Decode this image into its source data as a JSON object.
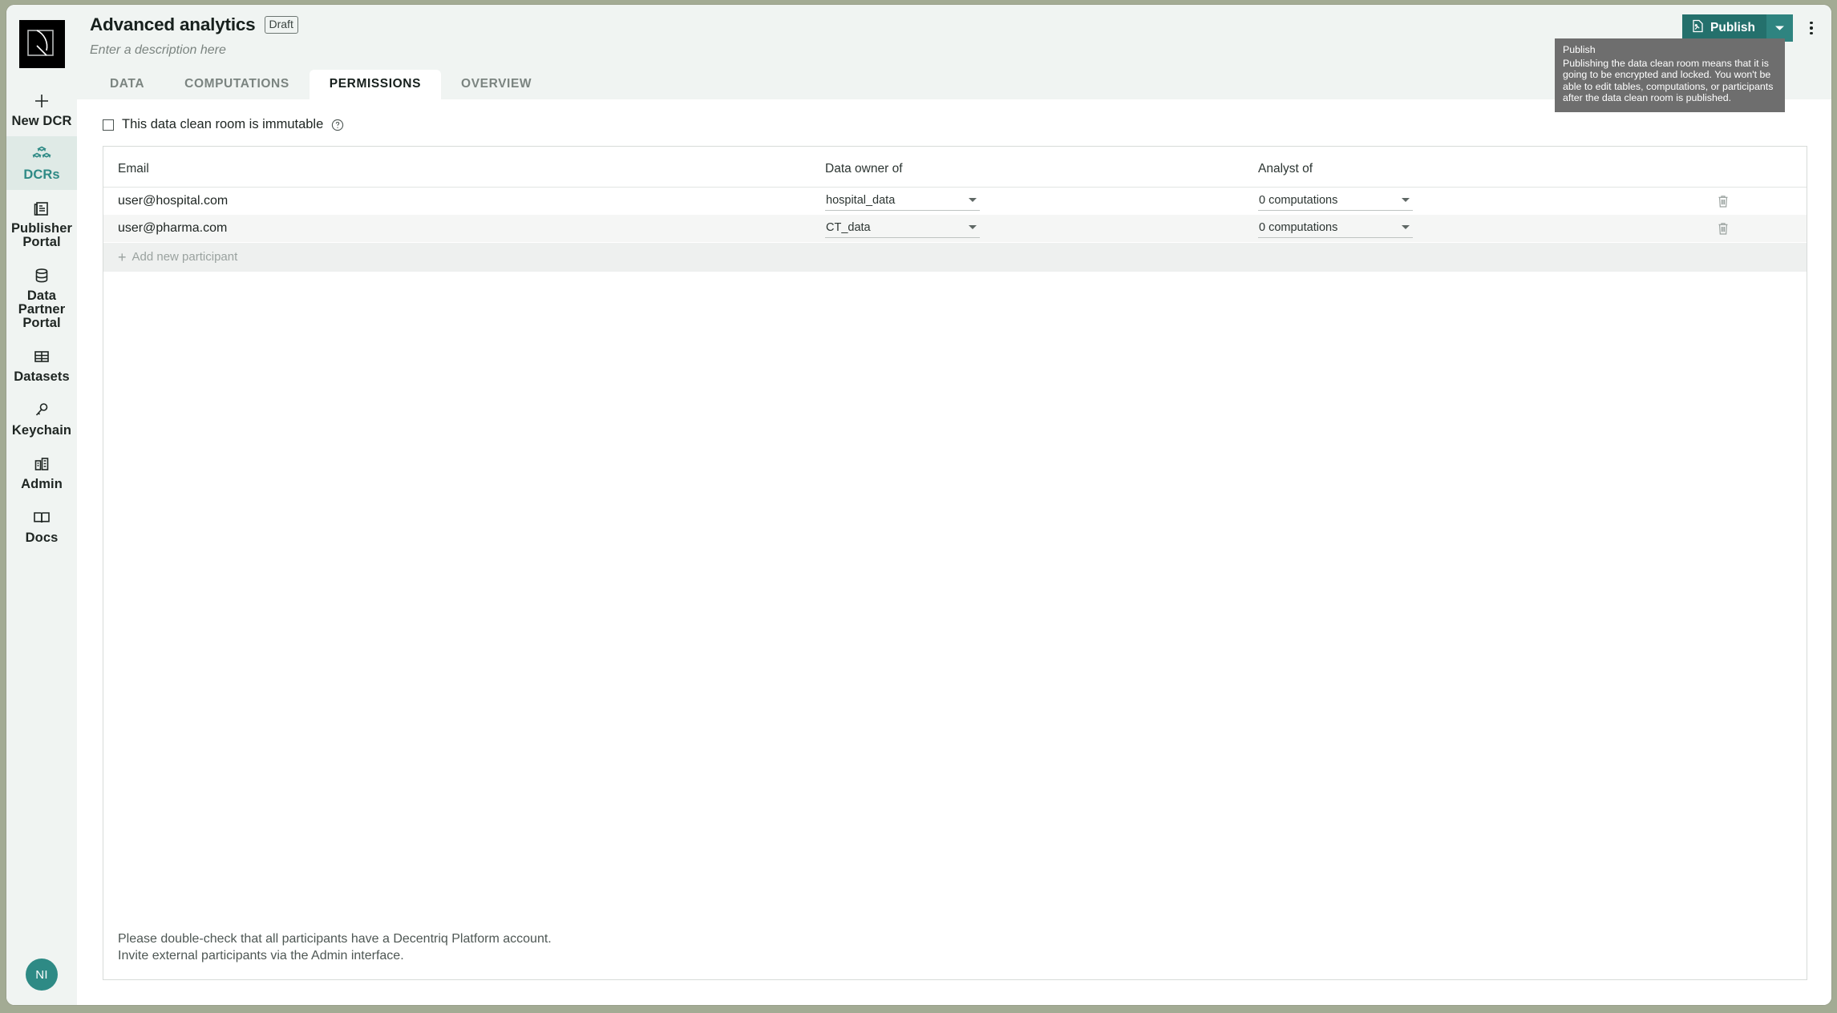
{
  "window": {
    "logo_name": "decentriq-logo"
  },
  "sidebar": {
    "items": [
      {
        "label": "New DCR",
        "icon": "plus-icon",
        "active": false
      },
      {
        "label": "DCRs",
        "icon": "cubes-icon",
        "active": true
      },
      {
        "label": "Publisher Portal",
        "icon": "newspaper-icon",
        "active": false
      },
      {
        "label": "Data Partner Portal",
        "icon": "database-icon",
        "active": false
      },
      {
        "label": "Datasets",
        "icon": "table-icon",
        "active": false
      },
      {
        "label": "Keychain",
        "icon": "key-icon",
        "active": false
      },
      {
        "label": "Admin",
        "icon": "buildings-icon",
        "active": false
      },
      {
        "label": "Docs",
        "icon": "book-icon",
        "active": false
      }
    ],
    "avatar_initials": "NI"
  },
  "header": {
    "title": "Advanced analytics",
    "badge": "Draft",
    "description_placeholder": "Enter a description here",
    "publish_label": "Publish",
    "publish_icon": "document-icon",
    "publish_caret_icon": "chevron-down-icon",
    "kebab_icon": "more-vertical-icon",
    "accent_color": "#24706c",
    "accent_color_light": "#2f8480"
  },
  "tooltip": {
    "title": "Publish",
    "body": "Publishing the data clean room means that it is going to be encrypted and locked. You won't be able to edit tables, computations, or participants after the data clean room is published."
  },
  "tabs": [
    {
      "label": "DATA",
      "active": false
    },
    {
      "label": "COMPUTATIONS",
      "active": false
    },
    {
      "label": "PERMISSIONS",
      "active": true
    },
    {
      "label": "OVERVIEW",
      "active": false
    }
  ],
  "immutable": {
    "label": "This data clean room is immutable",
    "checked": false,
    "help_icon": "question-circle-icon"
  },
  "table": {
    "columns": {
      "email": "Email",
      "data_owner_of": "Data owner of",
      "analyst_of": "Analyst of"
    },
    "rows": [
      {
        "email": "user@hospital.com",
        "data_owner_of": "hospital_data",
        "analyst_of": "0 computations"
      },
      {
        "email": "user@pharma.com",
        "data_owner_of": "CT_data",
        "analyst_of": "0 computations"
      }
    ],
    "add_row_label": "Add new participant"
  },
  "footer": {
    "line1": "Please double-check that all participants have a Decentriq Platform account.",
    "line2": "Invite external participants via the Admin interface."
  }
}
